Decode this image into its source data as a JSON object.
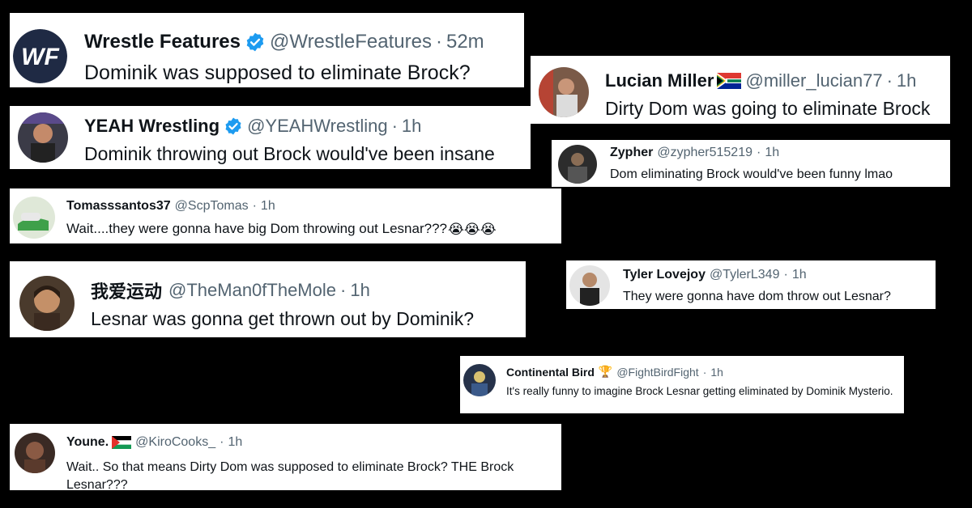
{
  "tweets": [
    {
      "id": "t1",
      "name": "Wrestle Features",
      "handle": "@WrestleFeatures",
      "sep": "·",
      "time": "52m",
      "verified": true,
      "avatar_text": "WF",
      "text": "Dominik was supposed to eliminate Brock?"
    },
    {
      "id": "t2",
      "name": "Lucian Miller",
      "handle": "@miller_lucian77",
      "sep": "·",
      "time": "1h",
      "flag": "south-africa-flag-icon",
      "text": "Dirty Dom was going to eliminate Brock"
    },
    {
      "id": "t3",
      "name": "YEAH Wrestling",
      "handle": "@YEAHWrestling",
      "sep": "·",
      "time": "1h",
      "verified": true,
      "text": "Dominik throwing out Brock would've been insane"
    },
    {
      "id": "t4",
      "name": "Zypher",
      "handle": "@zypher515219",
      "sep": "·",
      "time": "1h",
      "text": "Dom eliminating Brock would've been funny lmao"
    },
    {
      "id": "t5",
      "name": "Tomasssantos37",
      "handle": "@ScpTomas",
      "sep": "·",
      "time": "1h",
      "text": "Wait....they were gonna have big Dom throwing out Lesnar???",
      "emoji": "😭😭😭"
    },
    {
      "id": "t6",
      "name": "我爱运动",
      "handle": "@TheMan0fTheMole",
      "sep": "·",
      "time": "1h",
      "text": "Lesnar was gonna get thrown out by Dominik?"
    },
    {
      "id": "t7",
      "name": "Tyler Lovejoy",
      "handle": "@TylerL349",
      "sep": "·",
      "time": "1h",
      "text": "They were gonna have dom throw out Lesnar?"
    },
    {
      "id": "t8",
      "name": "Continental Bird",
      "handle": "@FightBirdFight",
      "sep": "·",
      "time": "1h",
      "trophy": "🏆",
      "text": "It's really funny to imagine Brock Lesnar getting eliminated by Dominik Mysterio."
    },
    {
      "id": "t9",
      "name": "Youne.",
      "handle": "@KiroCooks_",
      "sep": "·",
      "time": "1h",
      "flag": "palestine-flag-icon",
      "text": "Wait.. So that means Dirty Dom was supposed to eliminate Brock? THE Brock Lesnar???"
    }
  ],
  "colors": {
    "background": "#000000",
    "card": "#ffffff",
    "text": "#0f1419",
    "muted": "#536471",
    "verified": "#1d9bf0",
    "wf_logo_bg": "#1f2a44"
  }
}
